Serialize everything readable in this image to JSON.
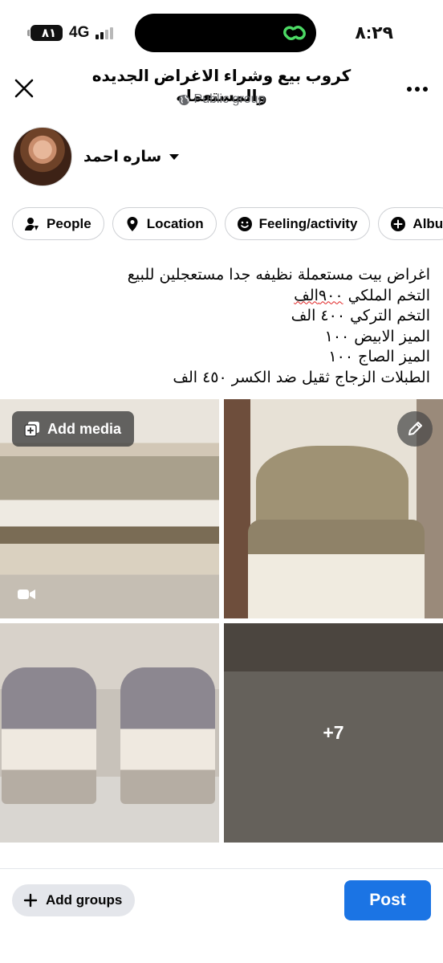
{
  "status_bar": {
    "battery": "٨١",
    "network": "4G",
    "time": "٨:٢٩"
  },
  "header": {
    "title": "كروب بيع وشراء الاغراض الجديده والمستعمله",
    "privacy": "Public group"
  },
  "author": {
    "name": "ساره احمد"
  },
  "chips": [
    {
      "label": "People",
      "icon": "person-tag-icon"
    },
    {
      "label": "Location",
      "icon": "location-pin-icon"
    },
    {
      "label": "Feeling/activity",
      "icon": "smiley-icon"
    },
    {
      "label": "Albu",
      "icon": "plus-circle-icon"
    }
  ],
  "post": {
    "lines": [
      "اغراض بيت مستعملة نظيفه جدا مستعجلين للبيع",
      "التخم الملكي ",
      "التخم التركي ٤٠٠ الف",
      "الميز الابيض ١٠٠",
      "الميز الصاج ١٠٠",
      "الطبلات الزجاج ثقيل ضد الكسر ٤٥٠ الف"
    ],
    "line2_misspelled": "٩٠٠الف"
  },
  "media": {
    "add_media_label": "Add media",
    "more_count": "+7"
  },
  "footer": {
    "add_groups_label": "Add groups",
    "post_label": "Post"
  },
  "colors": {
    "primary_blue": "#1b74e4",
    "chip_border": "#ced0d4",
    "secondary_text": "#65676b"
  }
}
